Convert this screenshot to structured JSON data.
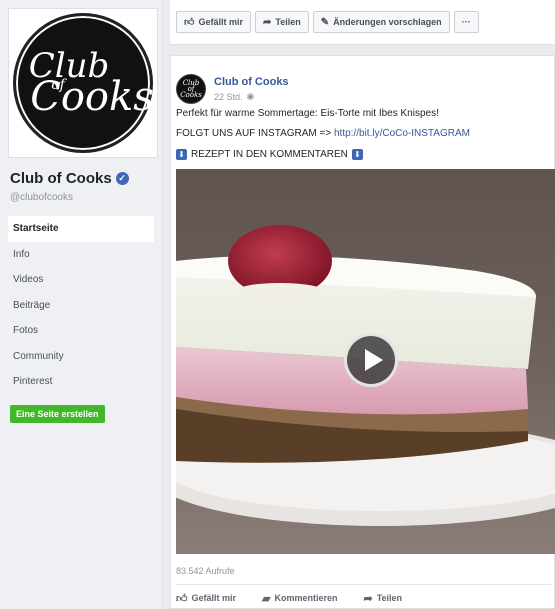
{
  "sidebar": {
    "logo": {
      "line1": "Club",
      "line2": "of",
      "line3": "Cooks"
    },
    "page_name": "Club of Cooks",
    "verified_icon": "✓",
    "handle": "@clubofcooks",
    "nav": [
      {
        "label": "Startseite"
      },
      {
        "label": "Info"
      },
      {
        "label": "Videos"
      },
      {
        "label": "Beiträge"
      },
      {
        "label": "Fotos"
      },
      {
        "label": "Community"
      },
      {
        "label": "Pinterest"
      }
    ],
    "create_page": "Eine Seite erstellen"
  },
  "actionbar": {
    "like": "Gefällt mir",
    "share": "Teilen",
    "suggest": "Änderungen vorschlagen",
    "more": "···"
  },
  "post": {
    "avatar": {
      "line1": "Club",
      "line2": "of",
      "line3": "Cooks"
    },
    "author": "Club of Cooks",
    "time": "22 Std.",
    "privacy_icon": "◉",
    "line1": "Perfekt für warme Sommertage: Eis-Torte mit Ibes Knispes!",
    "line2_prefix": "FOLGT UNS AUF INSTAGRAM => ",
    "line2_link": "http://bit.ly/CoCo-INSTAGRAM",
    "line3": "REZEPT IN DEN KOMMENTAREN",
    "views": "83.542 Aufrufe",
    "footer": {
      "like": "Gefällt mir",
      "comment": "Kommentieren",
      "share": "Teilen"
    }
  }
}
